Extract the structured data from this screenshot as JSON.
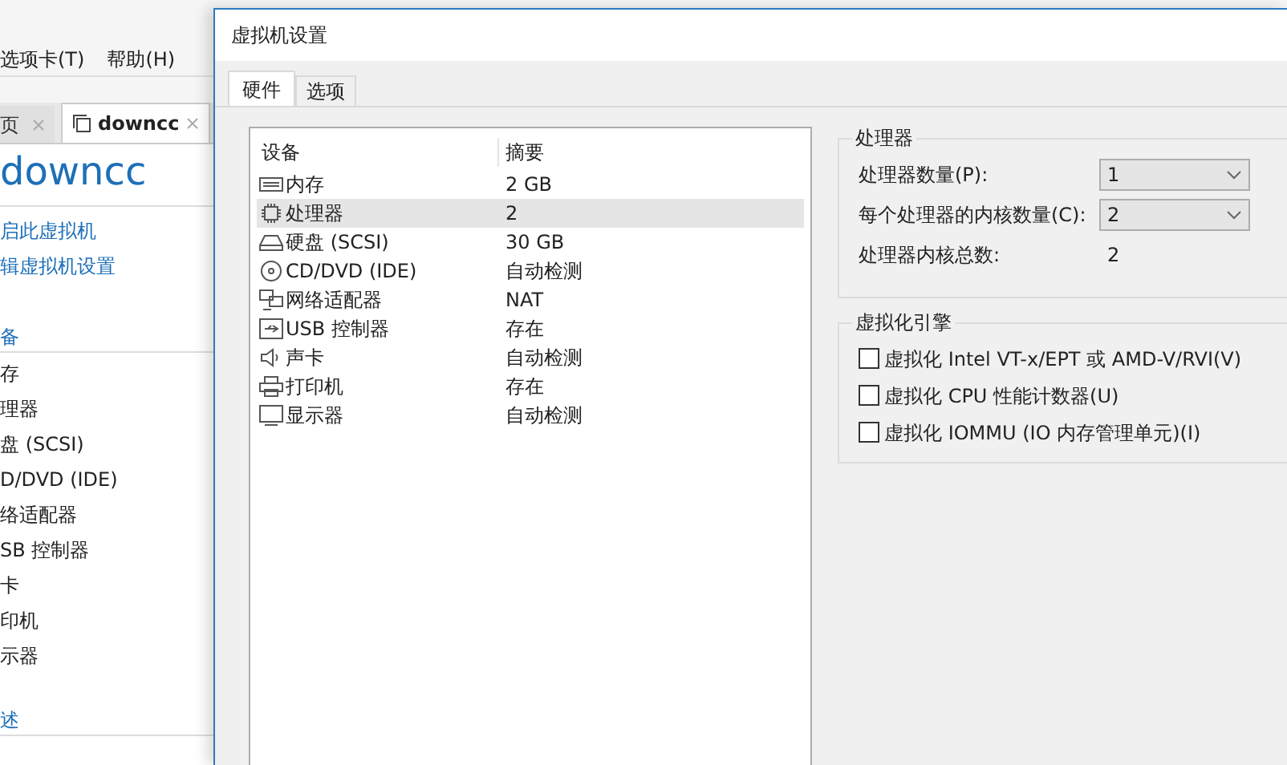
{
  "app": {
    "menu": [
      "选项卡(T)",
      "帮助(H)"
    ],
    "tabs": [
      {
        "label": "页",
        "selected": false
      },
      {
        "label": "downcc",
        "selected": true
      }
    ],
    "vm_title": "downcc",
    "actions": [
      "启此虚拟机",
      "辑虚拟机设置"
    ],
    "devices_heading": "备",
    "devices": [
      "存",
      "理器",
      "盘 (SCSI)",
      "D/DVD (IDE)",
      "络适配器",
      "SB 控制器",
      "卡",
      "印机",
      "示器"
    ],
    "description_heading": "述"
  },
  "dialog": {
    "title": "虚拟机设置",
    "tabs": [
      {
        "label": "硬件",
        "selected": true
      },
      {
        "label": "选项",
        "selected": false
      }
    ],
    "table": {
      "columns": [
        "设备",
        "摘要"
      ],
      "rows": [
        {
          "kind": "memory",
          "device": "内存",
          "summary": "2 GB",
          "selected": false
        },
        {
          "kind": "cpu",
          "device": "处理器",
          "summary": "2",
          "selected": true
        },
        {
          "kind": "disk",
          "device": "硬盘 (SCSI)",
          "summary": "30 GB",
          "selected": false
        },
        {
          "kind": "cd",
          "device": "CD/DVD (IDE)",
          "summary": "自动检测",
          "selected": false
        },
        {
          "kind": "network",
          "device": "网络适配器",
          "summary": "NAT",
          "selected": false
        },
        {
          "kind": "usb",
          "device": "USB 控制器",
          "summary": "存在",
          "selected": false
        },
        {
          "kind": "sound",
          "device": "声卡",
          "summary": "自动检测",
          "selected": false
        },
        {
          "kind": "printer",
          "device": "打印机",
          "summary": "存在",
          "selected": false
        },
        {
          "kind": "display",
          "device": "显示器",
          "summary": "自动检测",
          "selected": false
        }
      ]
    },
    "processors": {
      "title": "处理器",
      "fields": [
        {
          "label": "处理器数量(P):",
          "value": "1"
        },
        {
          "label": "每个处理器的内核数量(C):",
          "value": "2"
        }
      ],
      "total": {
        "label": "处理器内核总数:",
        "value": "2"
      }
    },
    "virtualization": {
      "title": "虚拟化引擎",
      "options": [
        {
          "label": "虚拟化 Intel VT-x/EPT 或 AMD-V/RVI(V)",
          "checked": false
        },
        {
          "label": "虚拟化 CPU 性能计数器(U)",
          "checked": false
        },
        {
          "label": "虚拟化 IOMMU (IO 内存管理单元)(I)",
          "checked": false
        }
      ]
    }
  }
}
